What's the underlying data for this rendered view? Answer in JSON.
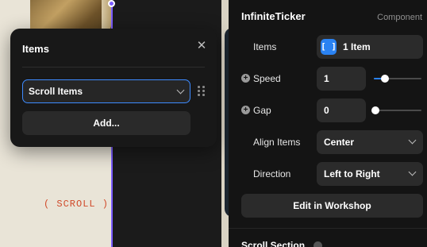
{
  "canvas": {
    "scroll_text": "( SCROLL )"
  },
  "items_popover": {
    "title": "Items",
    "selected_item": "Scroll Items",
    "add_label": "Add..."
  },
  "panel": {
    "component_name": "InfiniteTicker",
    "component_type": "Component",
    "items": {
      "label": "Items",
      "value": "1 Item",
      "badge": "[ ]"
    },
    "speed": {
      "label": "Speed",
      "value": "1",
      "slider_fraction": 0.2
    },
    "gap": {
      "label": "Gap",
      "value": "0",
      "slider_fraction": 0.0
    },
    "align_items": {
      "label": "Align Items",
      "value": "Center"
    },
    "direction": {
      "label": "Direction",
      "value": "Left to Right"
    },
    "workshop_label": "Edit in Workshop",
    "next_section_label": "Scroll Section"
  },
  "colors": {
    "accent": "#2a82f2",
    "selection": "#7b5cff",
    "scroll_text": "#d04a2a"
  }
}
